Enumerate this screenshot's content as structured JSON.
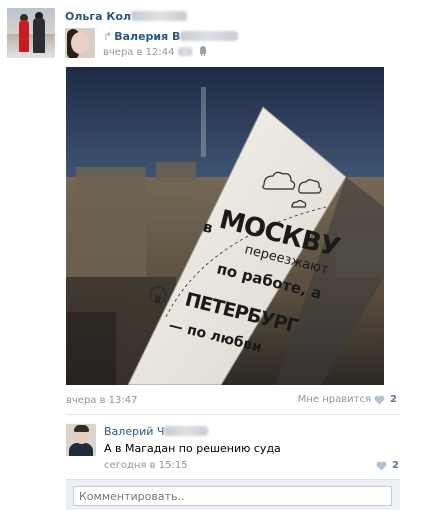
{
  "author": {
    "name_visible": "Ольга",
    "name_visible_continued": "Кол"
  },
  "repost": {
    "name_visible": "Валерия В",
    "time": "вчера в 12:44"
  },
  "photo": {
    "handwritten_text": [
      "в",
      "МОСКВУ",
      "переезжают",
      "по работе, а",
      "в",
      "ПЕТЕРБУРГ",
      "— по любви"
    ]
  },
  "post": {
    "date": "вчера в 13:47",
    "like_label": "Мне нравится",
    "like_count": "2"
  },
  "comment": {
    "author_visible": "Валерий Ч",
    "text": "А в Магадан по решению суда",
    "time": "сегодня в 15:15",
    "like_count": "2"
  },
  "comment_box": {
    "placeholder": "Комментировать.."
  },
  "colors": {
    "link": "#2b587a",
    "meta": "#8d96a0",
    "heart": "#b3c3d4",
    "comment_bg": "#edf1f5"
  }
}
